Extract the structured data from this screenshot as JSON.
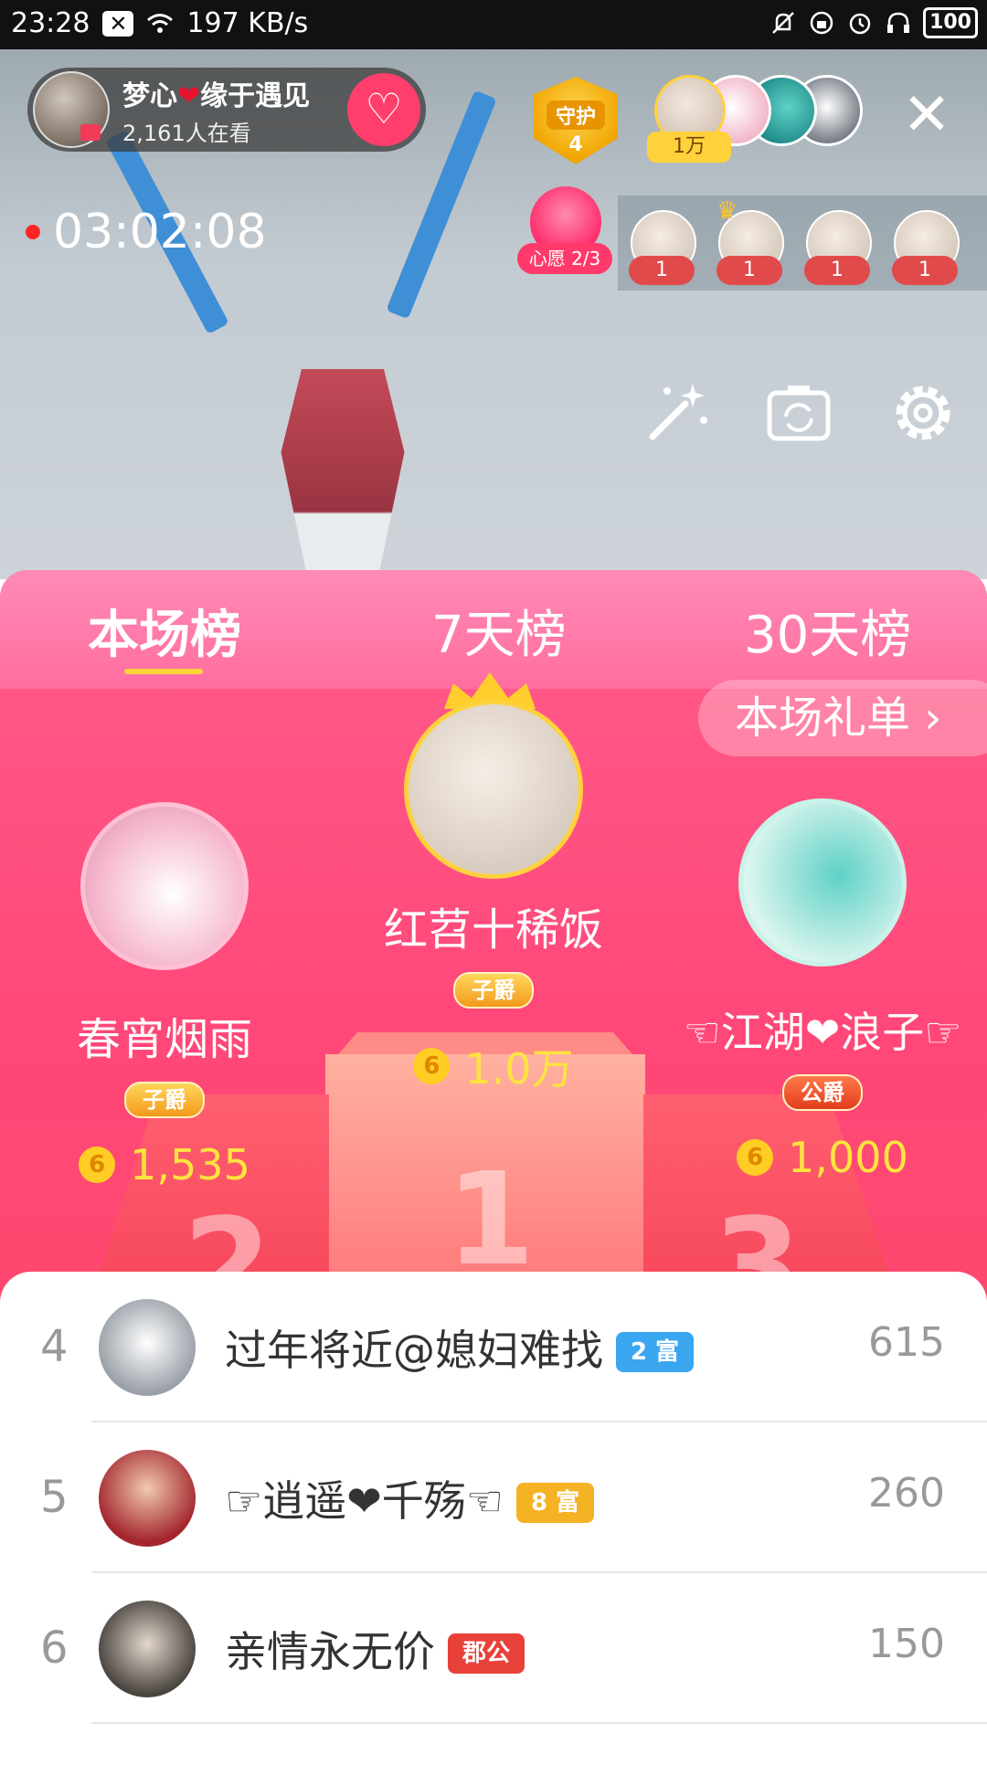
{
  "status_bar": {
    "time": "23:28",
    "net_speed": "197 KB/s",
    "battery": "100"
  },
  "anchor": {
    "name_part1": "梦心",
    "name_part2": "缘于遇见",
    "viewers": "2,161人在看"
  },
  "guard": {
    "label": "守护",
    "count": "4"
  },
  "top_viewer_label": "1万",
  "timer": "03:02:08",
  "wish": {
    "label": "心愿 2/3"
  },
  "ranking_strip": [
    "1",
    "1",
    "1",
    "1"
  ],
  "tabs": [
    {
      "label": "本场榜"
    },
    {
      "label": "7天榜"
    },
    {
      "label": "30天榜"
    }
  ],
  "gift_list_button": "本场礼单 ›",
  "podium": {
    "first": {
      "name": "红苕十稀饭",
      "badge": "子爵",
      "score": "1.0万",
      "rank": "1"
    },
    "second": {
      "name": "春宵烟雨",
      "badge": "子爵",
      "score": "1,535",
      "rank": "2"
    },
    "third": {
      "name": "☜江湖❤浪子☞",
      "badge": "公爵",
      "score": "1,000",
      "rank": "3"
    }
  },
  "list": [
    {
      "rank": "4",
      "name": "过年将近@媳妇难找",
      "level": "2 富",
      "level_color": "#3aa6f0",
      "score": "615"
    },
    {
      "rank": "5",
      "name": "☞逍遥❤千殇☜",
      "level": "8 富",
      "level_color": "#f5b225",
      "score": "260"
    },
    {
      "rank": "6",
      "name": "亲情永无价",
      "level": "郡公",
      "level_color": "#e8413a",
      "score": "150"
    }
  ],
  "colors": {
    "accent_pink": "#ff5c8c",
    "score_yellow": "#ffe43f",
    "tab_underline": "#ffd33a"
  },
  "icons": [
    "close-icon",
    "magic-wand-icon",
    "camera-flip-icon",
    "settings-gear-icon",
    "follow-heart-icon",
    "wifi-icon",
    "bell-off-icon",
    "alarm-icon",
    "headphones-icon",
    "coin-icon"
  ]
}
